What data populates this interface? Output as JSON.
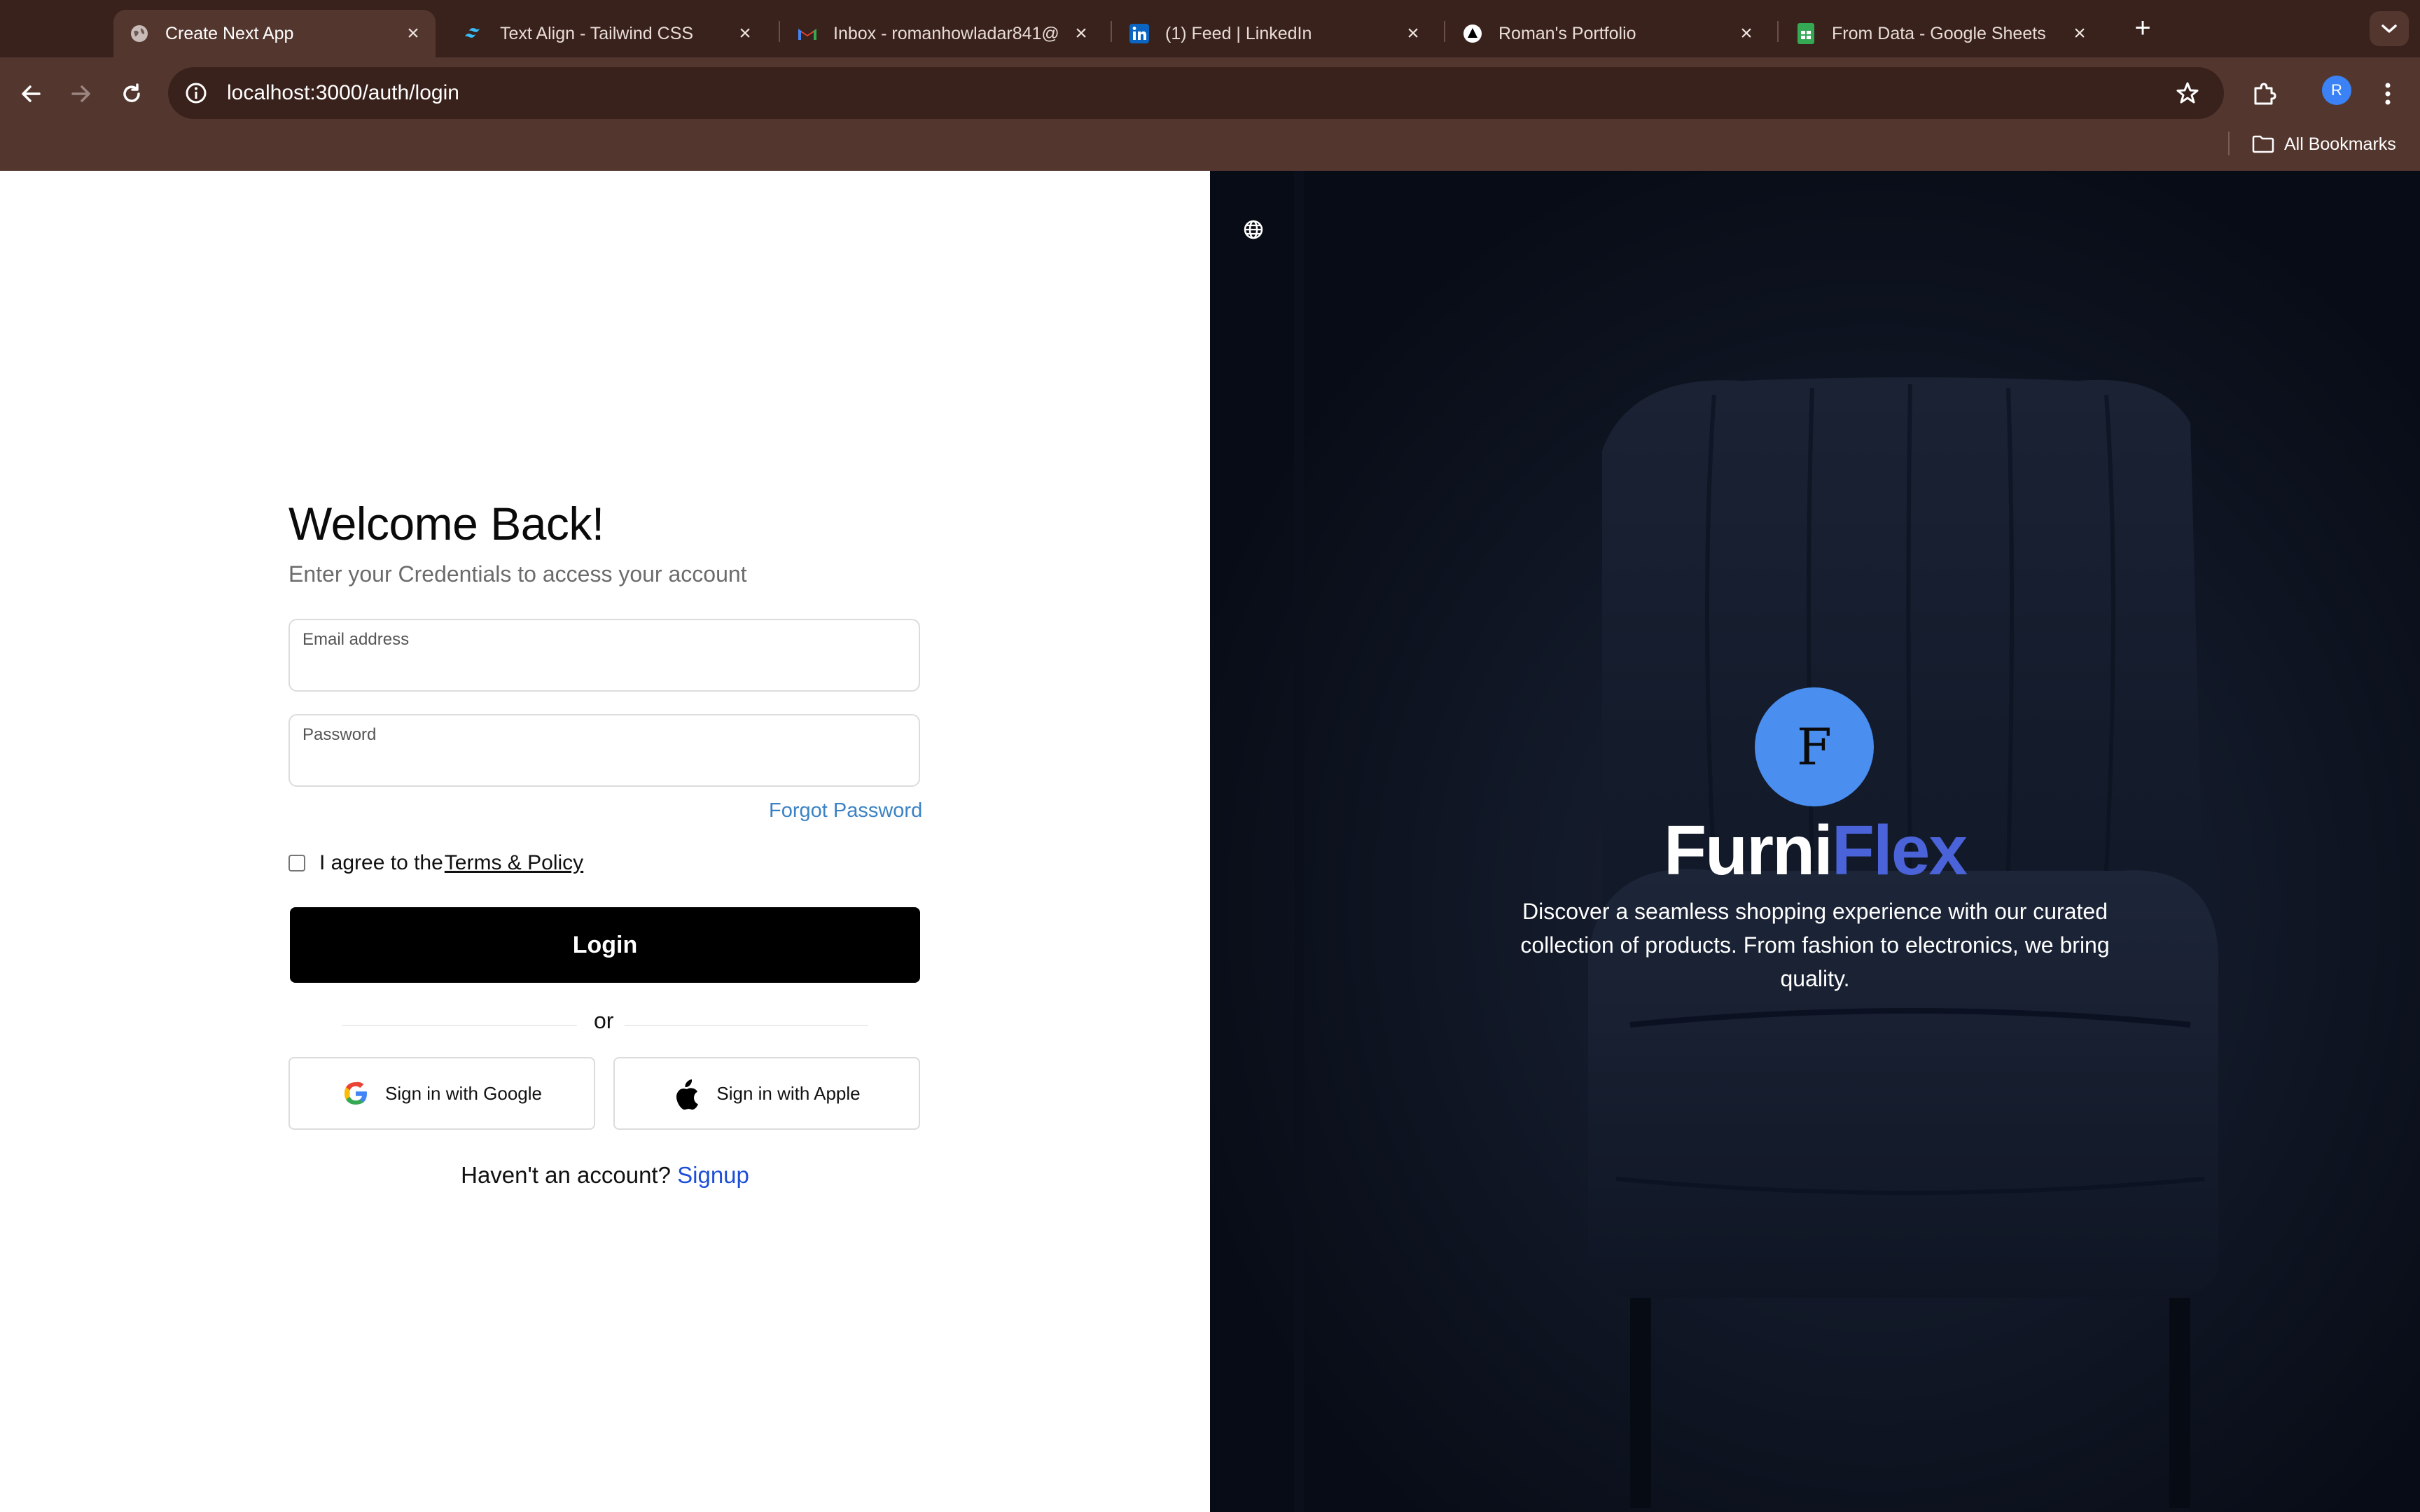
{
  "browser": {
    "tabs": [
      {
        "title": "Create Next App",
        "favicon": "globe-icon",
        "active": true
      },
      {
        "title": "Text Align - Tailwind CSS",
        "favicon": "tailwind-icon",
        "active": false
      },
      {
        "title": "Inbox - romanhowladar841@",
        "favicon": "gmail-icon",
        "active": false
      },
      {
        "title": "(1) Feed | LinkedIn",
        "favicon": "linkedin-icon",
        "active": false
      },
      {
        "title": "Roman's Portfolio",
        "favicon": "triangle-icon",
        "active": false
      },
      {
        "title": "From Data - Google Sheets",
        "favicon": "sheets-icon",
        "active": false
      }
    ],
    "url": "localhost:3000/auth/login",
    "profile_initial": "R",
    "bookmarks_label": "All Bookmarks",
    "colors": {
      "frame": "#3a221c",
      "toolbar": "#53372f"
    }
  },
  "login": {
    "title": "Welcome Back!",
    "subtitle": "Enter your Credentials to access your account",
    "email_label": "Email address",
    "email_value": "",
    "password_label": "Password",
    "password_value": "",
    "forgot_label": "Forgot Password",
    "agree_prefix": "I agree to the",
    "terms_label": " Terms & Policy",
    "agree_checked": false,
    "login_label": "Login",
    "or_label": "or",
    "google_label": "Sign in with Google",
    "apple_label": "Sign in with Apple",
    "signup_prompt": "Haven't an account? ",
    "signup_label": "Signup"
  },
  "brand": {
    "logo_letter": "F",
    "name_part1": "Furni",
    "name_part2": "Flex",
    "tagline": "Discover a seamless shopping experience with our curated collection of products. From fashion to electronics, we bring quality.",
    "colors": {
      "accent": "#4b63d8",
      "logo": "#4a8ef0",
      "panel": "#0c1220"
    }
  }
}
